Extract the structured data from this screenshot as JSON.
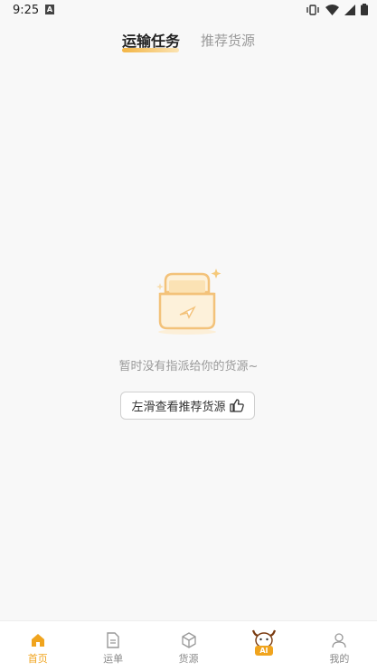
{
  "status_bar": {
    "time": "9:25",
    "notification": "A"
  },
  "tabs": {
    "active": "运输任务",
    "inactive": "推荐货源"
  },
  "empty_state": {
    "message": "暂时没有指派给你的货源~",
    "button_label": "左滑查看推荐货源"
  },
  "bottom_nav": {
    "items": [
      {
        "label": "首页",
        "icon": "home-icon"
      },
      {
        "label": "运单",
        "icon": "document-icon"
      },
      {
        "label": "货源",
        "icon": "box-icon"
      },
      {
        "label": "AI",
        "icon": "ai-mascot-icon"
      },
      {
        "label": "我的",
        "icon": "person-icon"
      }
    ]
  },
  "colors": {
    "accent": "#f0a41e",
    "background": "#f8f8f8"
  }
}
